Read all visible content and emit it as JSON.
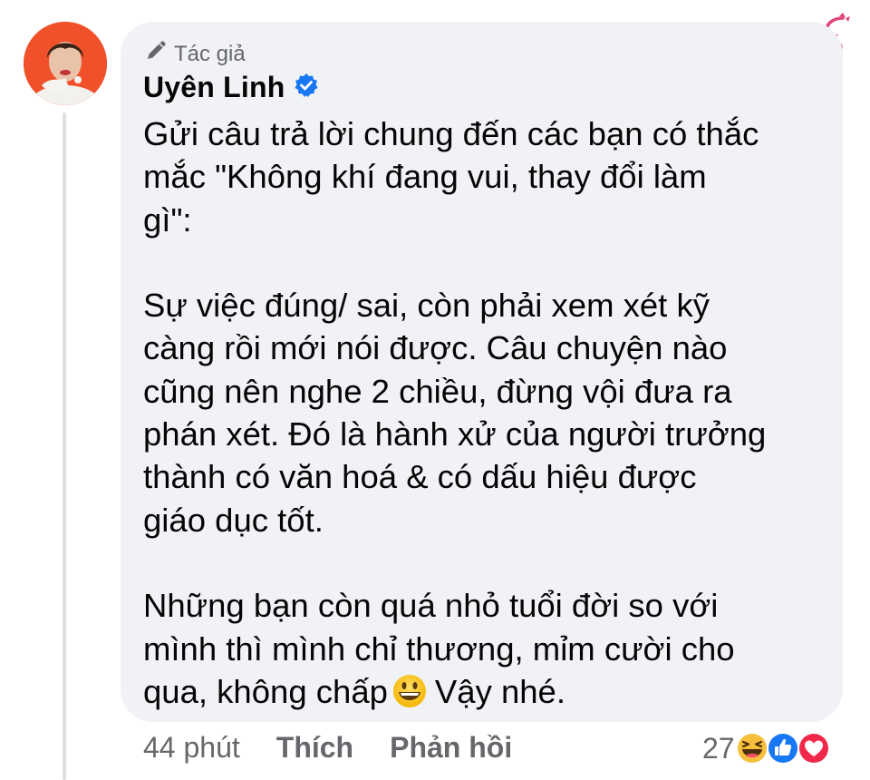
{
  "comment": {
    "author_badge": "Tác giả",
    "author_name": "Uyên Linh",
    "paragraphs": [
      {
        "lines": [
          "Gửi câu trả lời chung đến các bạn có thắc",
          "mắc \"Không khí đang vui, thay đổi làm",
          "gì\":"
        ]
      },
      {
        "lines": [
          "Sự việc đúng/ sai, còn phải xem xét kỹ",
          "càng rồi mới nói được. Câu chuyện nào",
          "cũng nên nghe 2 chiều, đừng vội đưa ra",
          "phán xét. Đó là hành xử của người trưởng",
          "thành có văn hoá & có dấu hiệu được",
          "giáo dục tốt."
        ]
      },
      {
        "lines": [
          "Những bạn còn quá nhỏ tuổi đời so với",
          "mình thì mình chỉ thương, mỉm cười cho"
        ],
        "last_line_before_emoji": "qua, không chấp",
        "last_line_after_emoji": "Vậy nhé."
      }
    ]
  },
  "actions": {
    "time": "44 phút",
    "like": "Thích",
    "reply": "Phản hồi"
  },
  "reactions": {
    "count": "27",
    "icons": [
      "haha-icon",
      "like-icon",
      "love-icon"
    ]
  },
  "colors": {
    "bubble": "#f0f2f5",
    "text": "#050505",
    "secondary": "#65676b",
    "verified": "#1877f2"
  }
}
